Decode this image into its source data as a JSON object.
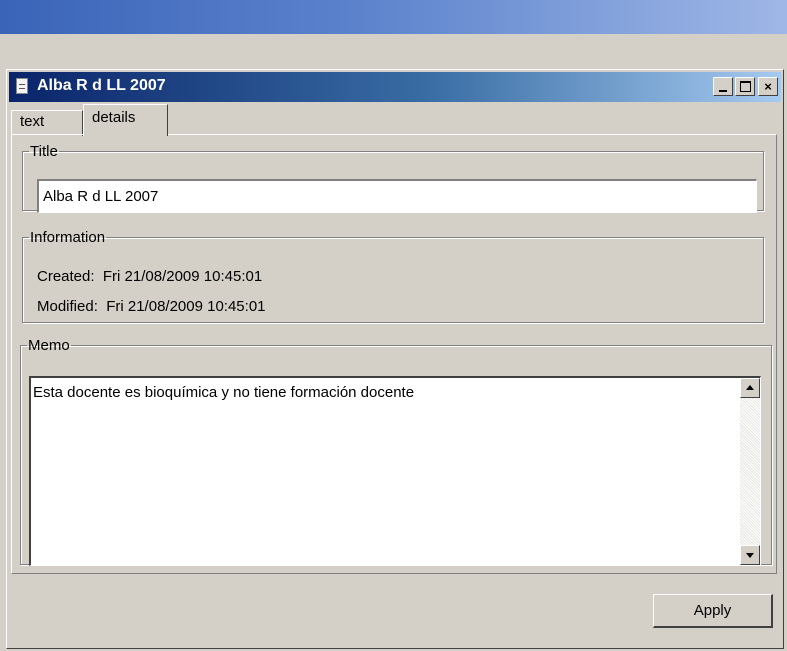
{
  "window": {
    "title": "Alba R d LL 2007"
  },
  "controls": {
    "minimize": "_",
    "maximize": "□",
    "close": "×"
  },
  "tabs": [
    {
      "label": "text",
      "selected": false
    },
    {
      "label": "details",
      "selected": true
    }
  ],
  "title_group": {
    "legend": "Title",
    "value": "Alba R d LL 2007"
  },
  "info_group": {
    "legend": "Information",
    "created_label": "Created:",
    "created_value": "Fri 21/08/2009 10:45:01",
    "modified_label": "Modified:",
    "modified_value": "Fri 21/08/2009 10:45:01"
  },
  "memo_group": {
    "legend": "Memo",
    "text": "Esta docente es bioquímica y no tiene formación docente"
  },
  "apply_label": "Apply",
  "colors": {
    "titlebar_start": "#0a246a",
    "titlebar_end": "#a6caf0",
    "face": "#d4d0c8"
  }
}
